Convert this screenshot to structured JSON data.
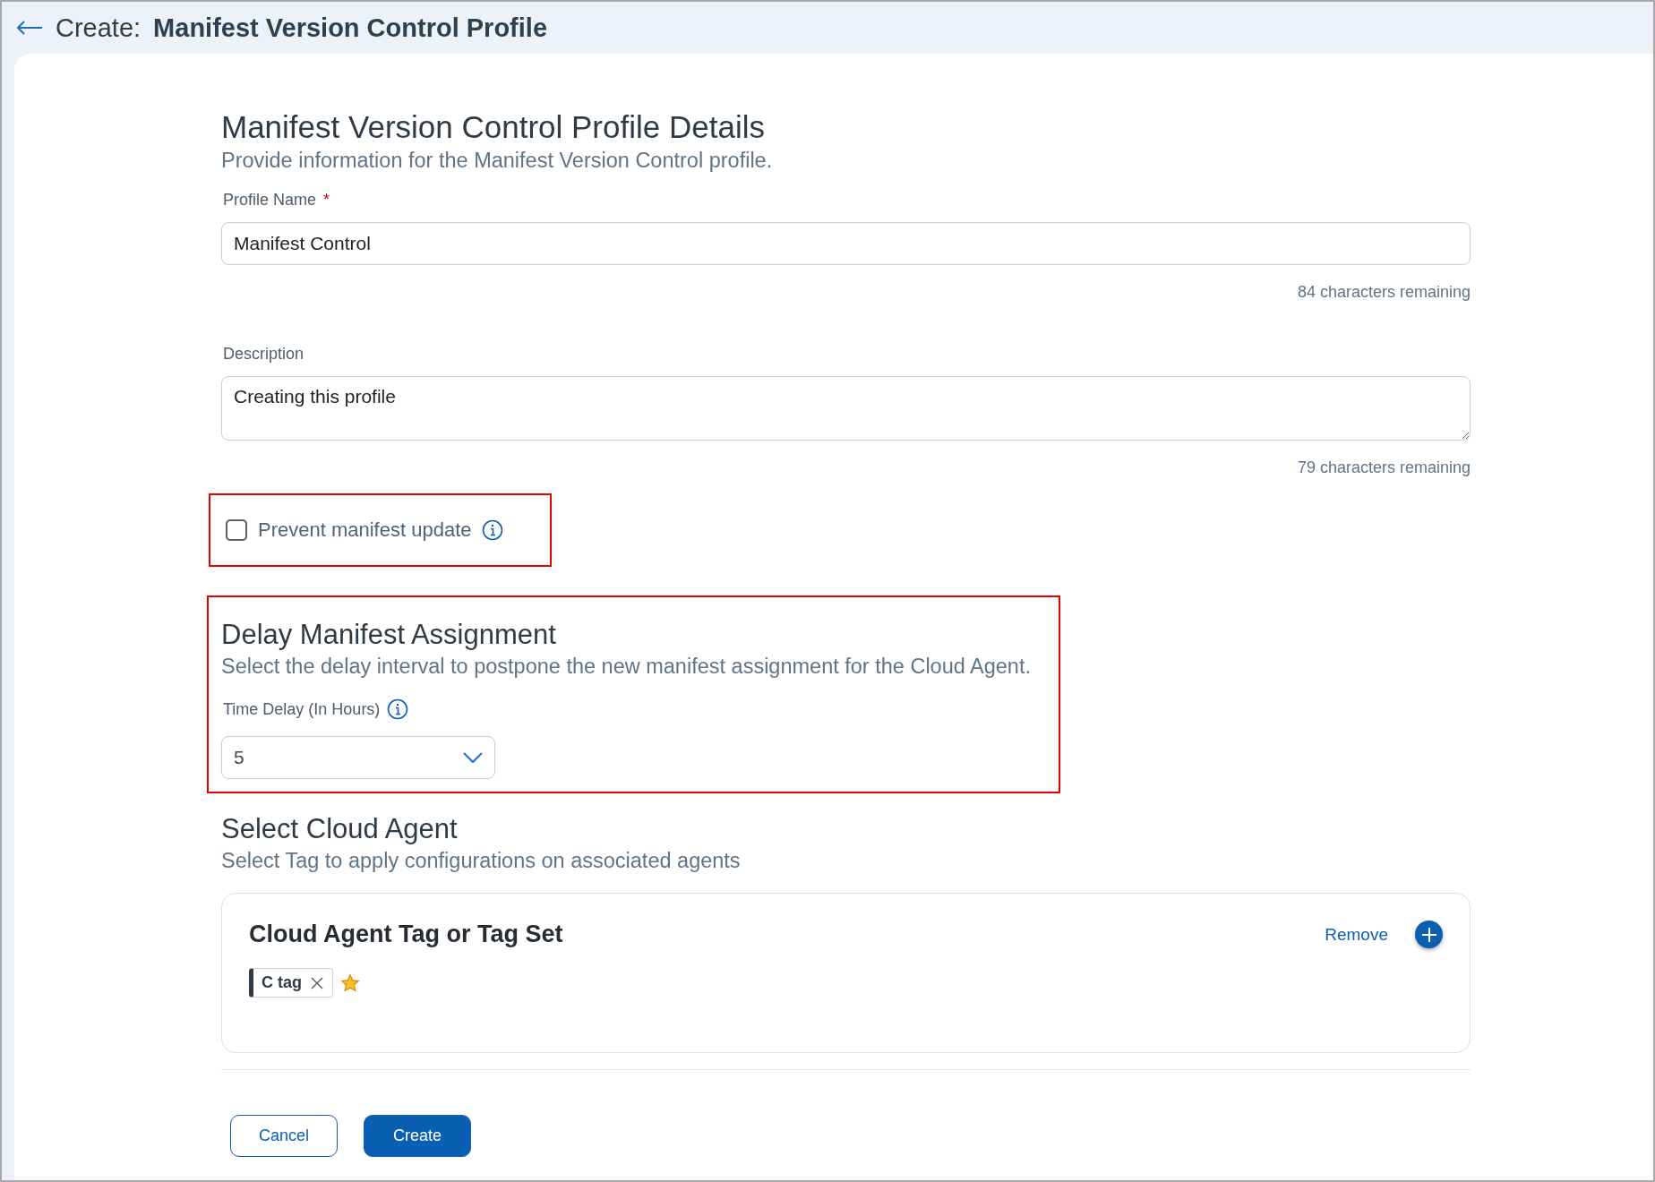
{
  "header": {
    "prefix": "Create:",
    "title": "Manifest Version Control Profile"
  },
  "details": {
    "title": "Manifest Version Control Profile Details",
    "subtitle": "Provide information for the Manifest Version Control profile.",
    "fields": [
      {
        "kind": "input",
        "label": "Profile Name",
        "required_mark": "*",
        "value": "Manifest Control",
        "counter": "84 characters remaining"
      },
      {
        "kind": "textarea",
        "label": "Description",
        "value": "Creating this profile",
        "counter": "79 characters remaining"
      }
    ]
  },
  "prevent_update": {
    "label": "Prevent manifest update",
    "checked": false,
    "highlighted": true
  },
  "delay": {
    "title": "Delay Manifest Assignment",
    "subtitle": "Select the delay interval to postpone the new manifest assignment for the Cloud Agent.",
    "field_label": "Time Delay (In Hours)",
    "value": "5",
    "highlighted": true
  },
  "cloud_agent": {
    "title": "Select Cloud Agent",
    "subtitle": "Select Tag to apply configurations on associated agents",
    "card": {
      "title": "Cloud Agent Tag or Tag Set",
      "remove": "Remove",
      "tags": [
        {
          "label": "C tag",
          "starred": true
        }
      ]
    }
  },
  "buttons": [
    {
      "label": "Cancel",
      "kind": "secondary"
    },
    {
      "label": "Create",
      "kind": "primary"
    }
  ]
}
